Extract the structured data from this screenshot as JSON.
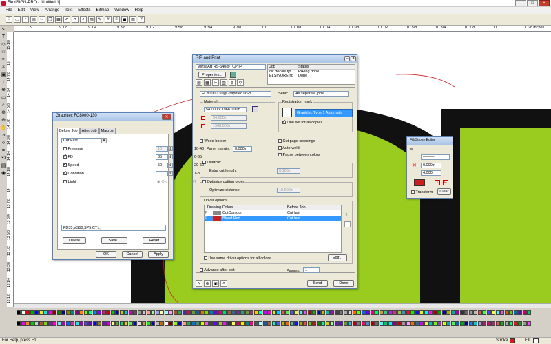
{
  "app": {
    "title": "FlexiSIGN-PRO - [Untitled 1]",
    "menu": [
      "File",
      "Edit",
      "View",
      "Arrange",
      "Text",
      "Effects",
      "Bitmap",
      "Window",
      "Help"
    ],
    "win_min": "–",
    "win_max": "□",
    "win_close": "✕"
  },
  "ruler": {
    "top": [
      "9",
      "9 1/8",
      "9 1/4",
      "9 3/8",
      "9 1/2",
      "9 5/8",
      "9 3/4",
      "9 7/8",
      "10",
      "10 1/8",
      "10 1/4",
      "10 3/8",
      "10 1/2",
      "10 5/8",
      "10 3/4",
      "10 7/8",
      "11",
      "11 1/8 inches"
    ],
    "left": [
      "15 1/8",
      "15",
      "14 7/8",
      "14 3/4",
      "14 5/8",
      "14 1/2",
      "14 3/8",
      "14 1/4",
      "14 1/8",
      "14",
      "13 7/8",
      "13 3/4",
      "13 5/8",
      "13 1/2",
      "13 3/8",
      "13 1/4",
      "13 1/8"
    ]
  },
  "rip": {
    "title": "RIP and Print",
    "printer": "VersaArt RS-640@TCP/IP",
    "properties": "Properties...",
    "job_header": "Job",
    "status_header": "Status",
    "jobs": [
      {
        "job": "cic decals.fjb",
        "status": "RIPing done"
      },
      {
        "job": "ELSINORE.fjb",
        "status": "Done"
      }
    ],
    "cutter": "FC8000-130@Graphtec USB",
    "send_label": "Send:",
    "send_value": "As separate jobs",
    "material_label": "Material",
    "material_value": "54.000 x 1968.000in",
    "width": "54.000in",
    "length": "1968.000in",
    "reg_label": "Registration mark",
    "reg_value": "Graphtec Type 1 Automatic",
    "one_set": "One set for all copies",
    "weed_border": "Weed border",
    "panel_margin": "Panel margin:",
    "panel_margin_value": "0.000in",
    "cut_crossings": "Cut page crossings",
    "auto_weld": "Auto-weld",
    "pause_colors": "Pause between colors",
    "overcut": "Overcut:",
    "extra_cut": "Extra cut length:",
    "extra_cut_value": "0.100in",
    "optimize": "Optimize cutting order",
    "optimize_distance": "Optimize distance:",
    "optimize_distance_value": "10.000in",
    "driver_options": "Driver options",
    "col_drawing": "Drawing Colors",
    "col_before": "Before Job",
    "drivers": [
      {
        "name": "CutContour",
        "value": "Cut fast"
      },
      {
        "name": "Blood Red",
        "value": "Cut fast"
      }
    ],
    "same_driver": "Use same driver options for all colors",
    "edit": "Edit...",
    "advance": "Advance after plot",
    "passes": "Passes:",
    "passes_value": "1",
    "send": "Send",
    "done": "Done"
  },
  "graphtec": {
    "title": "Graphtec FC8000-130",
    "tabs": [
      "Before Job",
      "After Job",
      "Macros"
    ],
    "mode": "Cut Fast",
    "rows": [
      {
        "label": "Pressure",
        "value": "10",
        "range": "10-48",
        "on": false
      },
      {
        "label": "FD",
        "value": "35",
        "range": "0-35",
        "on": true
      },
      {
        "label": "Speed",
        "value": "50",
        "range": "20-60",
        "on": true
      },
      {
        "label": "Condition",
        "value": "",
        "range": "1-8",
        "on": true
      },
      {
        "label": "Light",
        "value": "",
        "range": "",
        "on": false
      }
    ],
    "radio_on": "On",
    "radio_off": "Off",
    "command": "FD35;VS50;SP5;CT1;",
    "delete": "Delete",
    "save": "Save...",
    "reset": "Reset",
    "ok": "OK",
    "cancel": "Cancel",
    "apply": "Apply"
  },
  "fill": {
    "title": "Fill/Stroke Editor",
    "w1": "0.000in",
    "w2": "4.000",
    "transform": "Transform",
    "clear": "Clear"
  },
  "status": {
    "help": "For Help, press F1",
    "stroke": "Stroke",
    "fill": "Fill"
  },
  "colors": {
    "green": "#99cc1f",
    "black": "#111111",
    "red": "#cc1f1f",
    "selection": "#3399ff"
  },
  "palette": [
    "#000",
    "#fff",
    "#e00",
    "#0a0",
    "#00e",
    "#ee0",
    "#0ee",
    "#e0e",
    "#800",
    "#080",
    "#008",
    "#880",
    "#088",
    "#808",
    "#f80",
    "#8f0",
    "#0f8",
    "#08f",
    "#80f",
    "#f08",
    "#c00",
    "#0c0",
    "#00c",
    "#cc0",
    "#0cc",
    "#c0c",
    "#555",
    "#999",
    "#ccc",
    "#f99",
    "#9f9",
    "#99f",
    "#ff9",
    "#9ff",
    "#f9f",
    "#a52",
    "#2a5",
    "#52a",
    "#a25",
    "#5a2",
    "#25a",
    "#d70",
    "#7d0",
    "#07d",
    "#70d",
    "#d07",
    "#0d7",
    "#963",
    "#369",
    "#639",
    "#396",
    "#693",
    "#936",
    "#fc0",
    "#0fc",
    "#c0f",
    "#f0c",
    "#cf0",
    "#0cf",
    "#e55",
    "#5e5",
    "#55e",
    "#ee5",
    "#5ee",
    "#e5e",
    "#b00",
    "#0b0",
    "#00b",
    "#bb0",
    "#0bb",
    "#b0b",
    "#444",
    "#777",
    "#aaa",
    "#ddd",
    "#f60",
    "#6f0",
    "#06f",
    "#60f",
    "#f06",
    "#0f6",
    "#c93",
    "#3c9",
    "#93c",
    "#c39",
    "#9c3",
    "#39c",
    "#e11",
    "#1e1",
    "#11e",
    "#ee1",
    "#1ee",
    "#e1e",
    "#a00",
    "#0a0",
    "#00a",
    "#aa0",
    "#0aa",
    "#a0a",
    "#333",
    "#666",
    "#999",
    "#bbb",
    "#f44",
    "#4f4",
    "#44f",
    "#ff4",
    "#4ff",
    "#f4f",
    "#c60",
    "#6c0",
    "#06c",
    "#60c",
    "#c06",
    "#0c6"
  ]
}
